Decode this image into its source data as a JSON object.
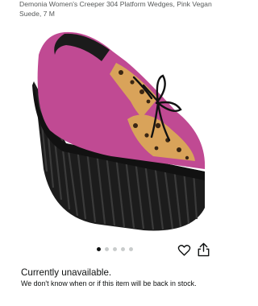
{
  "product": {
    "title": "Demonia Women's Creeper 304 Platform Wedges, Pink Vegan Suede, 7 M",
    "image_count": 5,
    "active_image": 1
  },
  "actions": {
    "wishlist_icon": "heart-icon",
    "share_icon": "share-icon"
  },
  "availability": {
    "status": "Currently unavailable.",
    "note": "We don't know when or if this item will be back in stock."
  },
  "colors": {
    "suede": "#c04a93",
    "sole": "#1c1c1c",
    "leopard": "#d9a35a"
  }
}
